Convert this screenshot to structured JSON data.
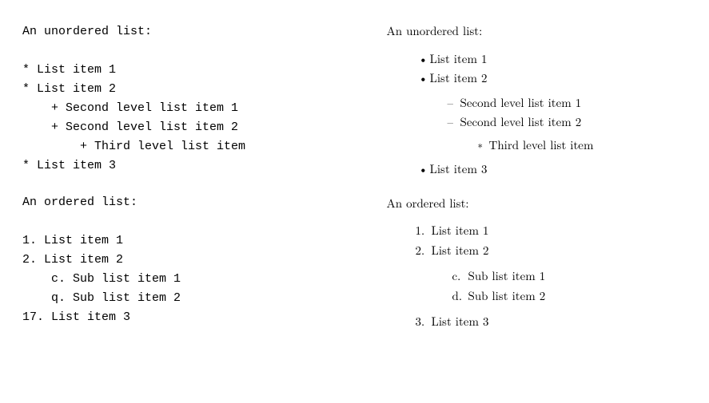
{
  "left": {
    "unordered_heading": "An unordered list:",
    "unordered_lines": [
      "* List item 1",
      "* List item 2",
      "    + Second level list item 1",
      "    + Second level list item 2",
      "        + Third level list item",
      "* List item 3"
    ],
    "ordered_heading": "An ordered list:",
    "ordered_lines": [
      "1. List item 1",
      "2. List item 2",
      "    c. Sub list item 1",
      "    q. Sub list item 2",
      "17. List item 3"
    ]
  },
  "right": {
    "unordered_heading": "An unordered list:",
    "unordered": {
      "items": [
        {
          "text": "List item 1"
        },
        {
          "text": "List item 2",
          "children": [
            {
              "text": "Second level list item 1"
            },
            {
              "text": "Second level list item 2",
              "children": [
                {
                  "text": "Third level list item"
                }
              ]
            }
          ]
        },
        {
          "text": "List item 3"
        }
      ]
    },
    "ordered_heading": "An ordered list:",
    "ordered": {
      "items": [
        {
          "marker": "1.",
          "text": "List item 1"
        },
        {
          "marker": "2.",
          "text": "List item 2",
          "children": [
            {
              "marker": "c.",
              "text": "Sub list item 1"
            },
            {
              "marker": "d.",
              "text": "Sub list item 2"
            }
          ]
        },
        {
          "marker": "3.",
          "text": "List item 3"
        }
      ]
    }
  }
}
